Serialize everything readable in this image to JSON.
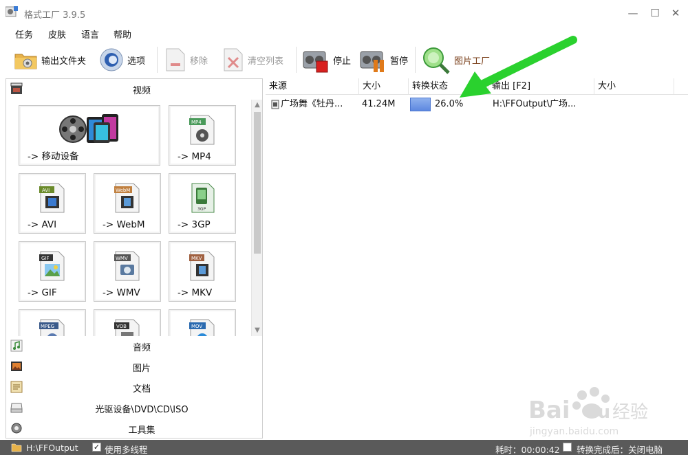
{
  "window": {
    "title": "格式工厂 3.9.5",
    "min_icon": "minimize-icon",
    "max_icon": "maximize-icon",
    "close_icon": "close-icon"
  },
  "menu": [
    "任务",
    "皮肤",
    "语言",
    "帮助"
  ],
  "toolbar": {
    "output_folder": "输出文件夹",
    "options": "选项",
    "remove": "移除",
    "clear_list": "清空列表",
    "stop": "停止",
    "pause": "暂停",
    "picture_factory": "图片工厂"
  },
  "sections": {
    "video": "视频",
    "audio": "音频",
    "picture": "图片",
    "document": "文档",
    "optical": "光驱设备\\DVD\\CD\\ISO",
    "tools": "工具集"
  },
  "formats": {
    "mobile": "-> 移动设备",
    "mp4": "-> MP4",
    "avi": "-> AVI",
    "webm": "-> WebM",
    "gp3": "-> 3GP",
    "gif": "-> GIF",
    "wmv": "-> WMV",
    "mkv": "-> MKV",
    "tags": {
      "mp4": "MP4",
      "avi": "AVI",
      "webm": "WebM",
      "gp3": "3GP",
      "gif": "GIF",
      "wmv": "WMV",
      "mkv": "MKV",
      "mpeg": "MPEG",
      "vob": "VOB",
      "mov": "MOV"
    }
  },
  "list": {
    "columns": [
      "来源",
      "大小",
      "转换状态",
      "输出 [F2]",
      "大小"
    ],
    "rows": [
      {
        "source": "广场舞《牡丹...",
        "size": "41.24M",
        "progress_text": "26.0%",
        "progress": 0.26,
        "output": "H:\\FFOutput\\广场...",
        "output_size": ""
      }
    ]
  },
  "status": {
    "output_path": "H:\\FFOutput",
    "multithread": "使用多线程",
    "elapsed": "耗时：00:00:42",
    "after_done": "转换完成后：关闭电脑"
  },
  "watermark": {
    "brand": "Bai",
    "brand2": "du",
    "cn": "经验",
    "url": "jingyan.baidu.com"
  },
  "colors": {
    "accent_blue": "#5d88e0",
    "arrow_green": "#29d12d",
    "statusbar": "#5a5a5a"
  }
}
